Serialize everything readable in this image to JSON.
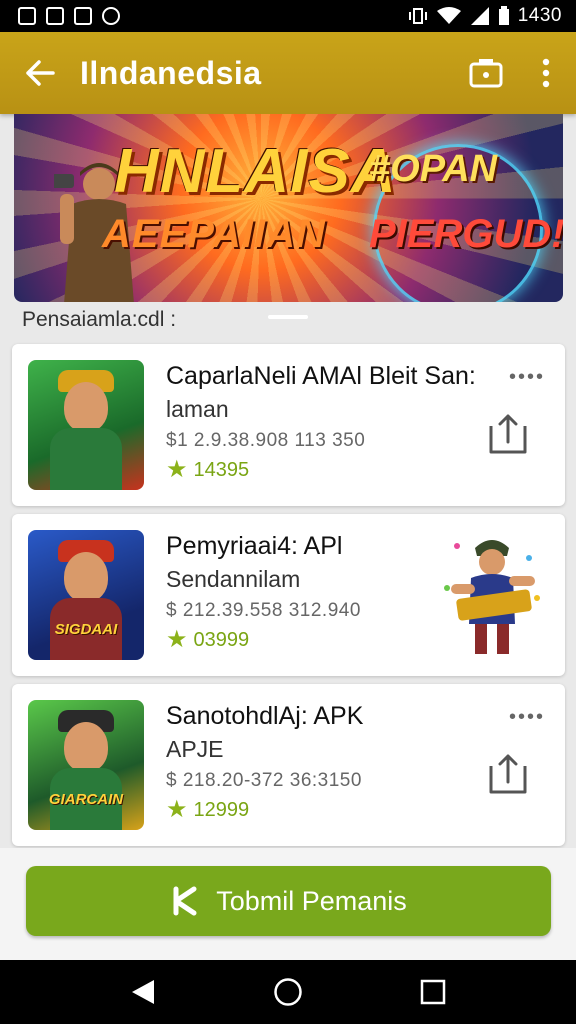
{
  "status_bar": {
    "time": "1430",
    "icons": [
      "image-icon",
      "image-icon",
      "image-icon",
      "sync-icon",
      "vibrate-icon",
      "wifi-icon",
      "signal-icon",
      "battery-icon"
    ]
  },
  "app_bar": {
    "title": "Ilndanedsia",
    "icons": [
      "back-arrow-icon",
      "camera-icon",
      "more-vert-icon"
    ]
  },
  "banner": {
    "title": "HNLAISA",
    "tag": "#OPAN",
    "subtitle_left": "AEEPAIIAN",
    "subtitle_right": "PIERGUD!"
  },
  "section_label": "Pensaiamla:cdl :",
  "cards": [
    {
      "title": "CaparlaNeli AMAl Bleit San:",
      "subtitle": "laman",
      "price": "$1 2.9.38.908 113 350",
      "rating": "14395",
      "action": "share"
    },
    {
      "title": "Pemyriaai4: APl",
      "subtitle": "Sendannilam",
      "price": "$ 212.39.558 312.940",
      "rating": "03999",
      "action": "mascot"
    },
    {
      "title": "SanotohdlAj: APK",
      "subtitle": "APJE",
      "price": "$ 218.20-372 36:3150",
      "rating": "12999",
      "action": "share"
    }
  ],
  "thumbs": [
    {
      "logo": "",
      "bg": "#2a9a3a"
    },
    {
      "logo": "SIGDAAI",
      "bg": "#1e3f9a"
    },
    {
      "logo": "GIARCAIN",
      "bg": "#3a7a2a"
    }
  ],
  "more_label": "••••",
  "cta": {
    "label": "Tobmil Pemanis",
    "color": "#79a81c"
  },
  "colors": {
    "app_bar": "#c9a419",
    "accent_green": "#79a81c"
  }
}
